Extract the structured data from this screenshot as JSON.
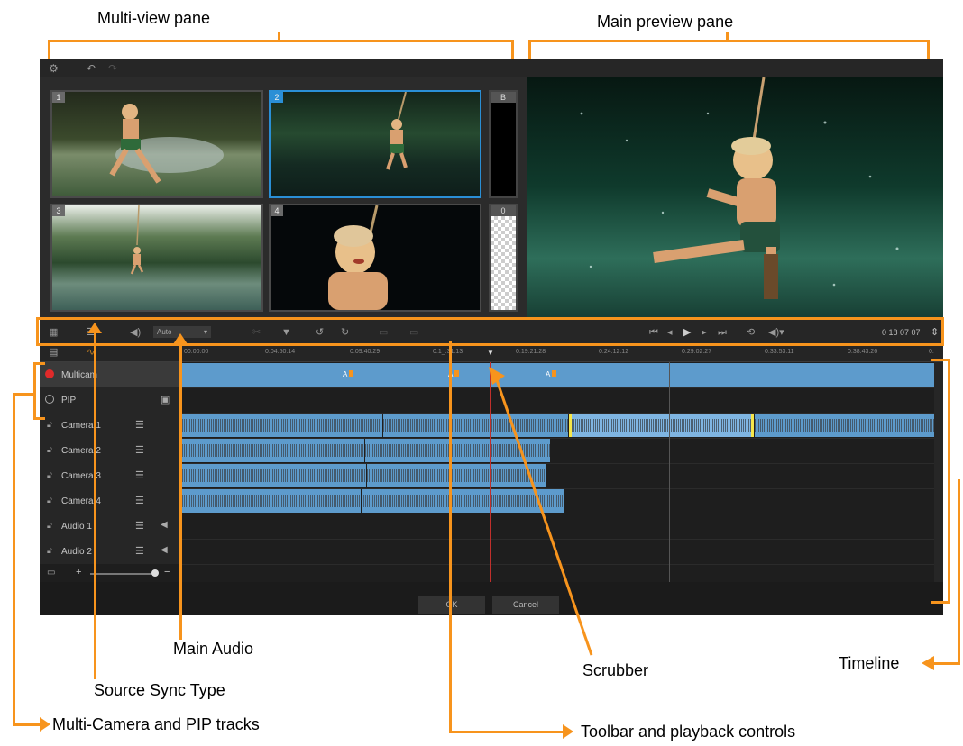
{
  "annotations": {
    "multi_view_pane": "Multi-view pane",
    "main_preview_pane": "Main preview pane",
    "main_audio": "Main Audio",
    "source_sync_type": "Source Sync Type",
    "multi_camera_pip_tracks": "Multi-Camera and PIP tracks",
    "scrubber": "Scrubber",
    "timeline": "Timeline",
    "toolbar_playback": "Toolbar and playback controls"
  },
  "multiview": {
    "tiles": [
      {
        "label": "1"
      },
      {
        "label": "2",
        "selected": true
      },
      {
        "label": "3"
      },
      {
        "label": "4"
      }
    ],
    "slot_b": "B",
    "slot_0": "0"
  },
  "toolbar": {
    "audio_dropdown_value": "Auto",
    "timecode": "0 18 07 07"
  },
  "ruler": {
    "ticks": [
      "00:00:00",
      "0:04:50.14",
      "0:09:40.29",
      "0:1_:31.13",
      "0:19:21.28",
      "0:24:12.12",
      "0:29:02.27",
      "0:33:53.11",
      "0:38:43.26",
      "0:"
    ]
  },
  "tracks": [
    {
      "name": "Multicam",
      "type": "multicam"
    },
    {
      "name": "PIP",
      "type": "pip"
    },
    {
      "name": "Camera 1",
      "type": "camera"
    },
    {
      "name": "Camera 2",
      "type": "camera"
    },
    {
      "name": "Camera 3",
      "type": "camera"
    },
    {
      "name": "Camera 4",
      "type": "camera"
    },
    {
      "name": "Audio 1",
      "type": "audio"
    },
    {
      "name": "Audio 2",
      "type": "audio"
    }
  ],
  "markers": [
    "A",
    "A",
    "A"
  ],
  "buttons": {
    "ok": "OK",
    "cancel": "Cancel"
  },
  "colors": {
    "accent": "#f7941d",
    "clip": "#5d9bcc",
    "selection": "#2a8fd6"
  }
}
